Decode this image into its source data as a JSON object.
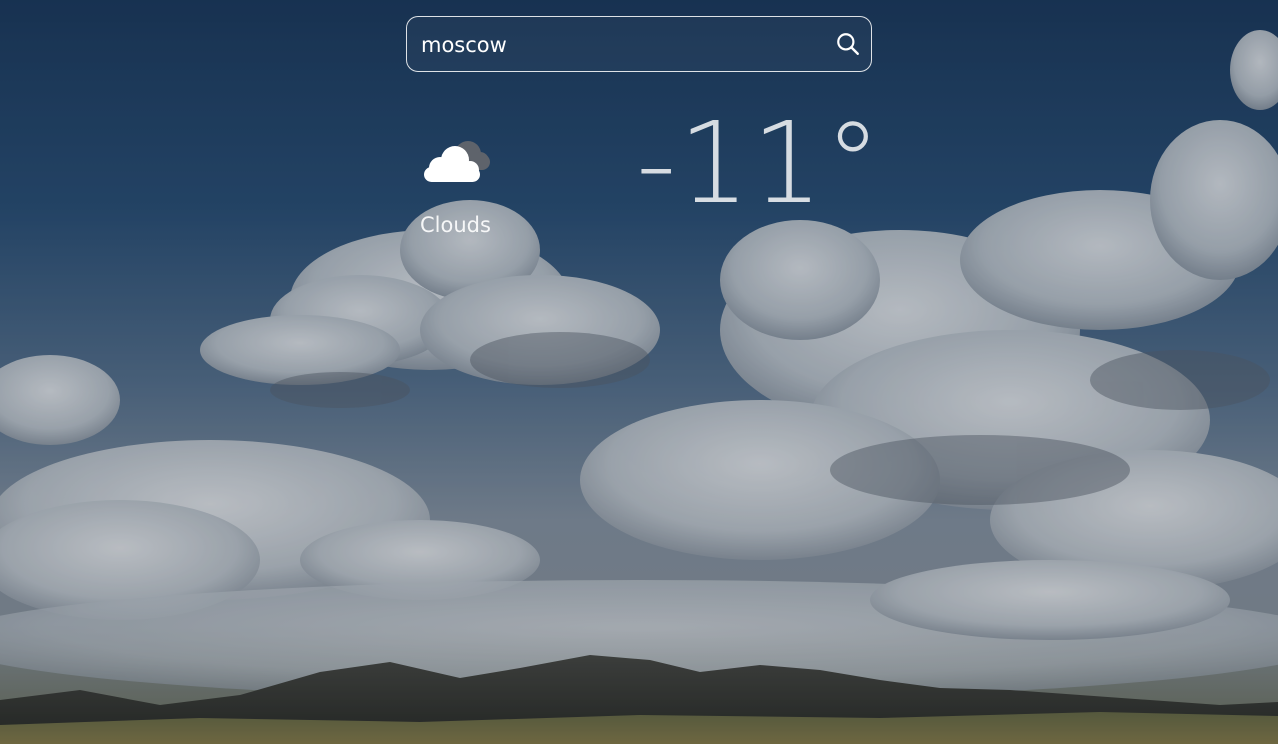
{
  "search": {
    "value": "moscow",
    "placeholder": ""
  },
  "weather": {
    "icon": "clouds-icon",
    "condition": "Clouds",
    "temperature": "-11°"
  },
  "icons": {
    "search": "search-icon"
  },
  "colors": {
    "text": "#ffffff",
    "sky_top": "#1c3b5f",
    "cloud": "#e9ecef",
    "hills": "#3a3a34"
  }
}
